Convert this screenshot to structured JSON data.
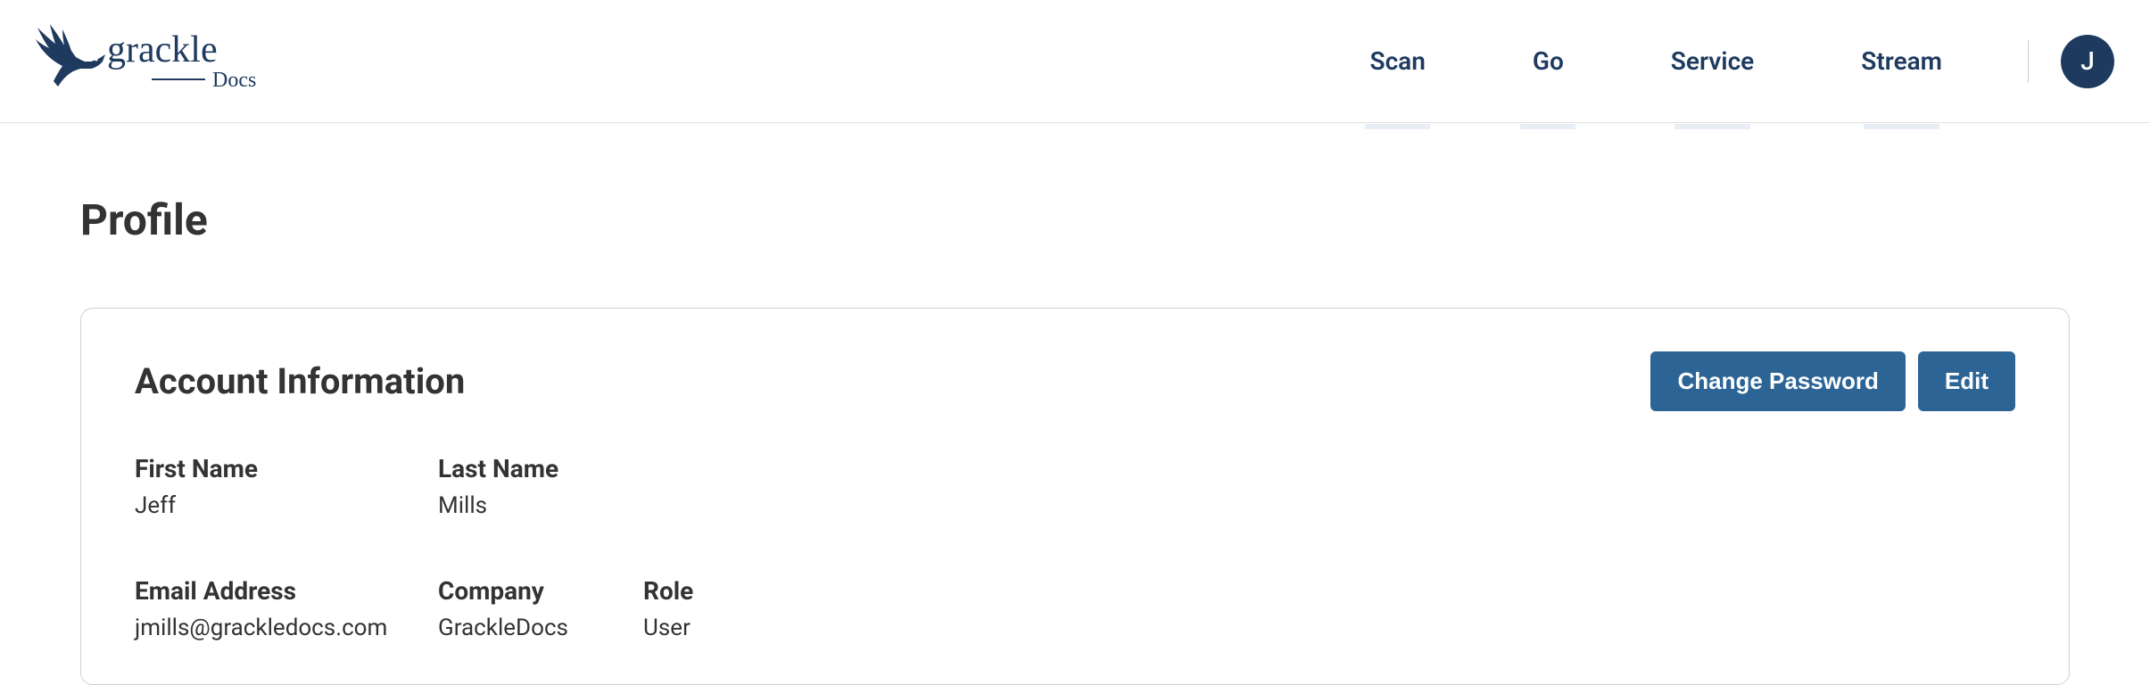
{
  "brand": {
    "name": "grackle",
    "subname": "Docs"
  },
  "nav": {
    "items": [
      {
        "label": "Scan"
      },
      {
        "label": "Go"
      },
      {
        "label": "Service"
      },
      {
        "label": "Stream"
      }
    ]
  },
  "avatar": {
    "initial": "J"
  },
  "page": {
    "title": "Profile"
  },
  "card": {
    "title": "Account Information",
    "buttons": {
      "change_password": "Change Password",
      "edit": "Edit"
    },
    "fields": {
      "first_name": {
        "label": "First Name",
        "value": "Jeff"
      },
      "last_name": {
        "label": "Last Name",
        "value": "Mills"
      },
      "email": {
        "label": "Email Address",
        "value": "jmills@grackledocs.com"
      },
      "company": {
        "label": "Company",
        "value": "GrackleDocs"
      },
      "role": {
        "label": "Role",
        "value": "User"
      }
    }
  }
}
